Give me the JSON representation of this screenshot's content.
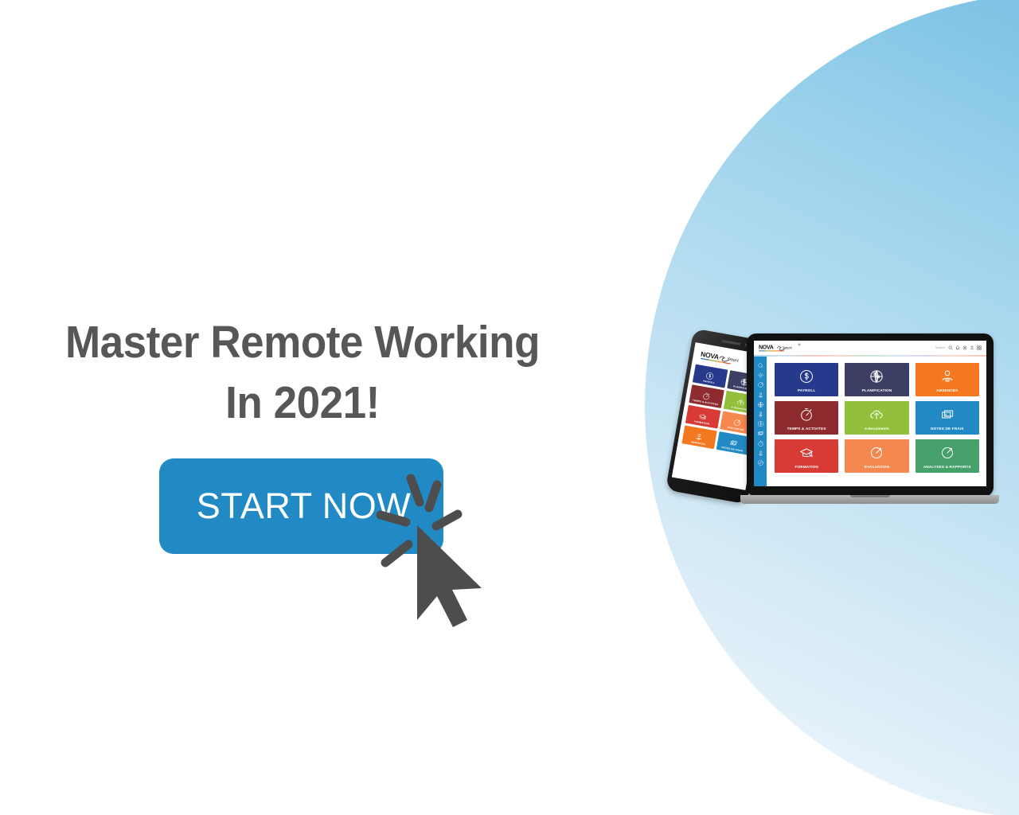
{
  "page": {
    "background_color": "#ffffff",
    "accent_color": "#2189c4",
    "circle_color_dark": "#59aedd",
    "circle_color_light": "#f1f7fc"
  },
  "hero": {
    "headline": "Master Remote Working\nIn 2021!",
    "headline_color": "#575757"
  },
  "cta": {
    "label": "START NOW",
    "background_color": "#2189c4",
    "text_color": "#ffffff",
    "cursor_icon": "mouse-cursor-click-icon",
    "cursor_color": "#4d4d4d"
  },
  "devices": {
    "phone": {
      "device_name": "smartphone-mockup",
      "logo_primary": "NOVA",
      "logo_secondary": "Smart",
      "tiles": [
        {
          "label": "PAYROLL",
          "color": "#26398a",
          "icon": "dollar-circle-icon"
        },
        {
          "label": "PLANIFICATION",
          "color": "#3c3f63",
          "icon": "calendar-globe-icon"
        },
        {
          "label": "TEMPS & ACTIVITÉS",
          "color": "#8e2b2e",
          "icon": "stopwatch-icon"
        },
        {
          "label": "e-documents",
          "color": "#93c03c",
          "icon": "cloud-upload-icon"
        },
        {
          "label": "FORMATION",
          "color": "#d83a36",
          "icon": "graduation-cap-icon"
        },
        {
          "label": "ÉVALUATION",
          "color": "#f5884f",
          "icon": "target-arrow-icon"
        },
        {
          "label": "ABSENCES",
          "color": "#f4781f",
          "icon": "person-badge-icon"
        },
        {
          "label": "NOTES DE FRAIS",
          "color": "#2189c4",
          "icon": "expense-cards-icon"
        }
      ]
    },
    "laptop": {
      "device_name": "laptop-mockup",
      "app": {
        "logo_primary": "NOVA",
        "logo_secondary": "Smart",
        "search_label": "Search",
        "header_icons": [
          "search-icon",
          "bell-icon",
          "gear-icon",
          "user-icon",
          "grid-apps-icon"
        ],
        "sidebar_icons": [
          "search-icon",
          "gear-icon",
          "target-arrow-icon",
          "person-badge-icon",
          "globe-network-icon",
          "person-lock-icon",
          "dollar-circle-icon",
          "expense-cards-icon",
          "stopwatch-icon",
          "person-card-icon",
          "pencil-circle-icon"
        ],
        "tiles": [
          {
            "label": "PAYROLL",
            "color": "#26398a",
            "icon": "dollar-circle-icon"
          },
          {
            "label": "PLANIFICATION",
            "color": "#3c3f63",
            "icon": "calendar-globe-icon"
          },
          {
            "label": "ABSENCES",
            "color": "#f4781f",
            "icon": "person-badge-icon"
          },
          {
            "label": "TEMPS & ACTIVITÉS",
            "color": "#8e2b2e",
            "icon": "stopwatch-icon"
          },
          {
            "label": "e-documents",
            "color": "#93c03c",
            "icon": "cloud-upload-icon"
          },
          {
            "label": "NOTES DE FRAIS",
            "color": "#2189c4",
            "icon": "expense-cards-icon"
          },
          {
            "label": "FORMATION",
            "color": "#d83a36",
            "icon": "graduation-cap-icon"
          },
          {
            "label": "ÉVALUATION",
            "color": "#f5884f",
            "icon": "target-arrow-icon"
          },
          {
            "label": "ANALYSES & RAPPORTS",
            "color": "#45a06a",
            "icon": "target-arrow-icon"
          }
        ]
      }
    }
  }
}
